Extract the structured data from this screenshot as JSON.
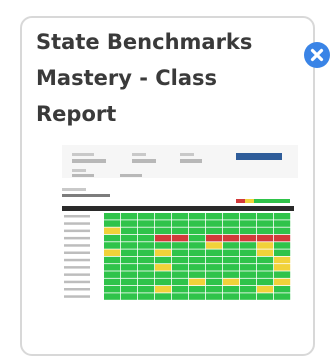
{
  "card": {
    "title": "State Benchmarks Mastery - Class Report",
    "close_icon": "close-circle-icon",
    "thumbnail": {
      "description_icon": "report-preview-image",
      "colors": {
        "green": "#2fc34a",
        "yellow": "#f1d23a",
        "red": "#d23a3a",
        "header_dark": "#2a2a2a",
        "button_blue": "#2f5d9a"
      },
      "heatmap_rows": [
        "GGGGGGGGGGG",
        "GGGGGGGGGGG",
        "YGGGGGGGGGG",
        "GGGRRGRRRRR",
        "GGGGGGYGGYG",
        "YGGYGGGGGYG",
        "GGGGGGGGGGY",
        "GGGYGGGGGGY",
        "GGGGGGGGGGG",
        "GGGGGYGYGGY",
        "GGGYGGGGGYG",
        "GGGGGGGGGGG"
      ]
    }
  }
}
